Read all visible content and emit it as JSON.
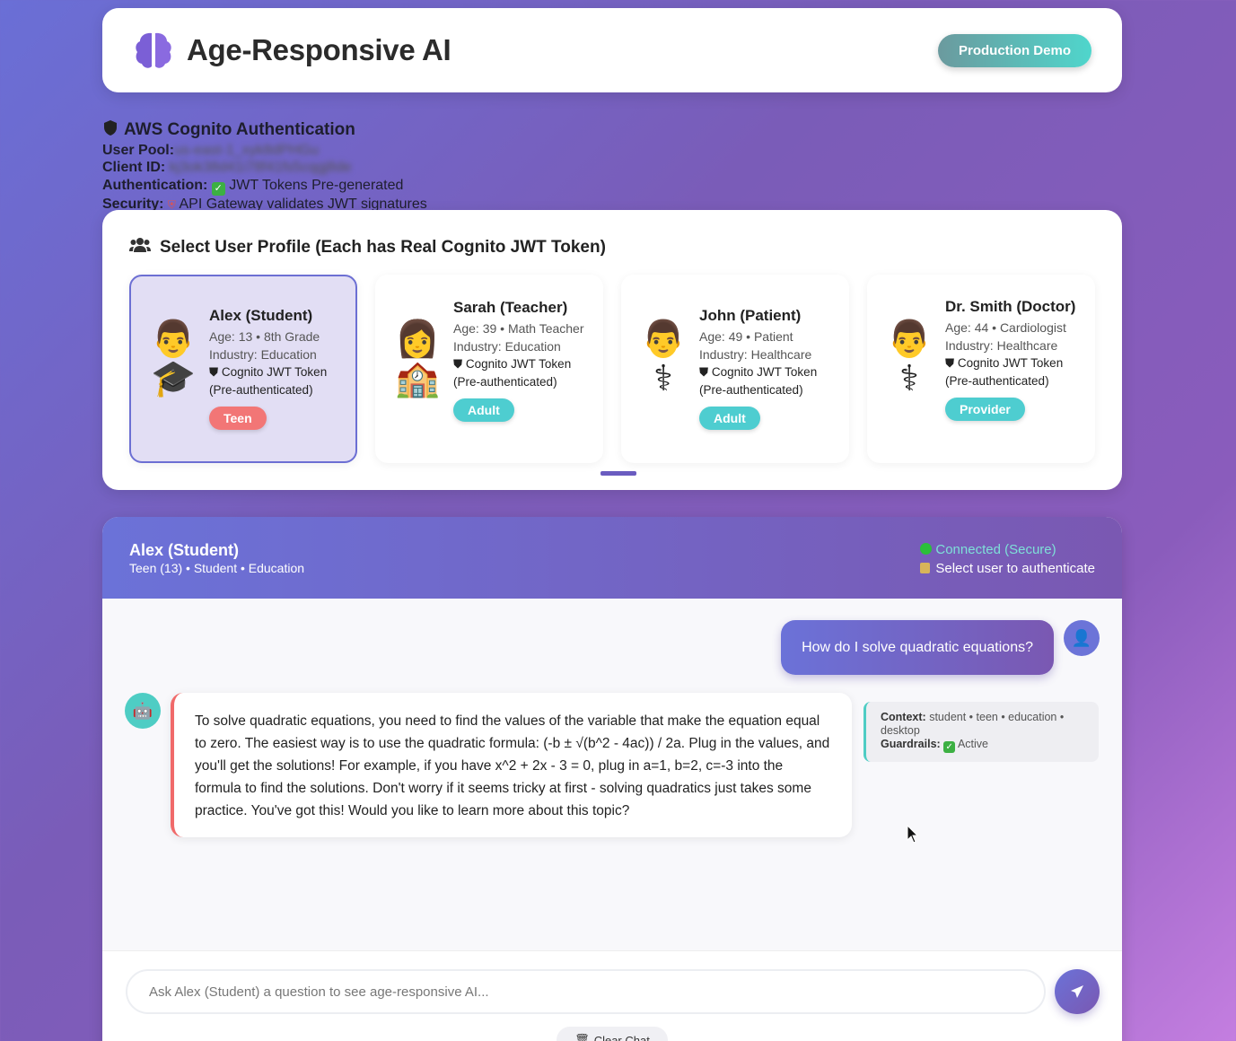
{
  "header": {
    "title": "Age-Responsive AI",
    "demo_label": "Production Demo",
    "logo_icon": "brain-icon"
  },
  "auth": {
    "heading": "AWS Cognito Authentication",
    "pool_label": "User Pool:",
    "pool_value": "us-east-1_xyk8dPHGu",
    "client_label": "Client ID:",
    "client_value": "kj3ok38d41i78f41fs5cqgj8de",
    "auth_label": "Authentication:",
    "auth_value": "JWT Tokens Pre-generated",
    "security_label": "Security:",
    "security_value": "API Gateway validates JWT signatures"
  },
  "profiles": {
    "title": "Select User Profile (Each has Real Cognito JWT Token)",
    "cards": [
      {
        "name": "Alex (Student)",
        "age": "Age: 13 • 8th Grade",
        "industry": "Industry: Education",
        "token": "Cognito JWT Token",
        "pre": "(Pre-authenticated)",
        "badge": "Teen",
        "emoji": "👨",
        "emoji2": "🎓"
      },
      {
        "name": "Sarah (Teacher)",
        "age": "Age: 39 • Math Teacher",
        "industry": "Industry: Education",
        "token": "Cognito JWT Token",
        "pre": "(Pre-authenticated)",
        "badge": "Adult",
        "emoji": "👩",
        "emoji2": "🏫"
      },
      {
        "name": "John (Patient)",
        "age": "Age: 49 • Patient",
        "industry": "Industry: Healthcare",
        "token": "Cognito JWT Token",
        "pre": "(Pre-authenticated)",
        "badge": "Adult",
        "emoji": "👨",
        "emoji2": "⚕"
      },
      {
        "name": "Dr. Smith (Doctor)",
        "age": "Age: 44 • Cardiologist",
        "industry": "Industry: Healthcare",
        "token": "Cognito JWT Token",
        "pre": "(Pre-authenticated)",
        "badge": "Provider",
        "emoji": "👨",
        "emoji2": "⚕"
      }
    ]
  },
  "chat": {
    "user_name": "Alex (Student)",
    "user_sub": "Teen (13) • Student • Education",
    "status_connected": "Connected (Secure)",
    "status_auth": "Select user to authenticate",
    "user_message": "How do I solve quadratic equations?",
    "bot_message": "To solve quadratic equations, you need to find the values of the variable that make the equation equal to zero. The easiest way is to use the quadratic formula: (-b ± √(b^2 - 4ac)) / 2a. Plug in the values, and you'll get the solutions! For example, if you have x^2 + 2x - 3 = 0, plug in a=1, b=2, c=-3 into the formula to find the solutions. Don't worry if it seems tricky at first - solving quadratics just takes some practice. You've got this! Would you like to learn more about this topic?",
    "context_label": "Context:",
    "context_value": "student • teen • education • desktop",
    "guardrails_label": "Guardrails:",
    "guardrails_value": "Active",
    "input_placeholder": "Ask Alex (Student) a question to see age-responsive AI...",
    "clear_label": "Clear Chat"
  },
  "colors": {
    "accent": "#6b72d8",
    "teal": "#4ecdc4",
    "teen": "#f27676"
  }
}
